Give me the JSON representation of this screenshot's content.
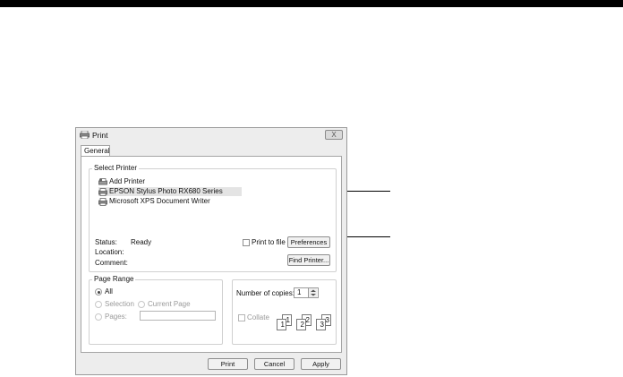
{
  "dialog": {
    "title": "Print",
    "close_label": "X",
    "tab_label": "General"
  },
  "select_printer": {
    "legend": "Select Printer",
    "printers": [
      {
        "label": "Add Printer",
        "icon": "add-printer-icon",
        "selected": false
      },
      {
        "label": "EPSON Stylus Photo RX680 Series",
        "icon": "printer-icon",
        "selected": true
      },
      {
        "label": "Microsoft XPS Document Writer",
        "icon": "printer-icon",
        "selected": false
      }
    ],
    "status_label": "Status:",
    "status_value": "Ready",
    "location_label": "Location:",
    "comment_label": "Comment:",
    "print_to_file_label": "Print to file",
    "preferences_label": "Preferences",
    "find_printer_label": "Find Printer..."
  },
  "page_range": {
    "legend": "Page Range",
    "all_label": "All",
    "selection_label": "Selection",
    "current_page_label": "Current Page",
    "pages_label": "Pages:",
    "pages_value": ""
  },
  "copies": {
    "label": "Number of copies:",
    "value": "1",
    "collate_label": "Collate",
    "collate_pages": [
      "1",
      "1",
      "2",
      "2",
      "3",
      "3"
    ]
  },
  "buttons": {
    "print": "Print",
    "cancel": "Cancel",
    "apply": "Apply"
  },
  "colors": {
    "selection_highlight": "#e4e4e4",
    "window_background": "#ededed"
  }
}
